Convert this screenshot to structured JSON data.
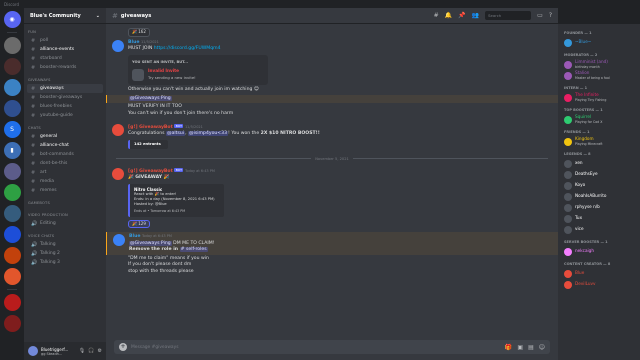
{
  "window": {
    "title": "Discord"
  },
  "server": {
    "name": "Blue's Community"
  },
  "categories": {
    "fun": "FUN",
    "giveaways": "GIVEAWAYS",
    "chats": "CHATS",
    "gamebots": "GAMEBOTS",
    "video_production": "VIDEO PRODUCTION",
    "voice_chats": "VOICE CHATS"
  },
  "fun_channels": [
    "poll",
    "alliance-events",
    "starboard",
    "booster-rewards"
  ],
  "giveaway_channels": [
    "giveaways",
    "booster-giveaways",
    "blues-freebies",
    "youtube-guide"
  ],
  "chat_channels": [
    "general",
    "alliance-chat",
    "bot-commands",
    "dont-be-this",
    "art",
    "media",
    "memes"
  ],
  "video_channels": [
    "Editing"
  ],
  "voice_channels": [
    "Talking",
    "Talking 2",
    "Talking 3"
  ],
  "user": {
    "name": "Bluetriggerf...",
    "tag": "gg Steadh..."
  },
  "chat": {
    "channel": "giveaways",
    "search_placeholder": "Search",
    "composer_placeholder": "Message #giveaways"
  },
  "messages": {
    "r1": "162",
    "m1_user": "Blue",
    "m1_time": "11/5/2021",
    "m1_text": "MUST JOIN ",
    "m1_link": "https://discord.gg/FUWMqm4",
    "invite_head": "YOU SENT AN INVITE, BUT...",
    "invite_title": "Invalid Invite",
    "invite_sub": "Try sending a new invite!",
    "m1_l2": "Otherwise you can't win and actually join im watching",
    "m1_l3": "@Giveaways Ping",
    "m1_l4": "MUST VERIFY IN IT TOO",
    "m1_l5": "You can't win if you don't join there's no harm",
    "m2_user": "[g!] GiveawayBot",
    "bot": "BOT",
    "m2_time": "11/5/2021",
    "m2_pre": "Congratulations ",
    "m2_men1": "@altsui",
    "m2_men2": "@isimp4you<33",
    "m2_mid": "! You won the ",
    "m2_prize": "2X $10 NITRO BOOST!!",
    "m2_entrants": "142 entrants",
    "date_divider": "November 5, 2021",
    "m3_user": "[g!] GiveawayBot",
    "m3_time": "Today at 6:43 PM",
    "m3_head": "GIVEAWAY",
    "embed_title": "Nitro Classic",
    "embed_l1": "React with 🎉 to enter!",
    "embed_l2": "Ends: in a day (November 8, 2021 6:43 PM)",
    "embed_l3": "Hosted by: @Blue",
    "embed_footer": "Ends at • Tomorrow at 6:43 PM",
    "r3": "129",
    "m4_user": "Blue",
    "m4_time": "Today at 6:43 PM",
    "m4_mention": "@Giveaways Ping",
    "m4_text": " DM ME TO CLAIM!",
    "m4_l2": "Remove the role in ",
    "m4_channel": "self-roles",
    "m4_l3": "\"DM me to claim\" means if you win",
    "m4_l4": "If you don't please dont dm",
    "m4_l5": "stop with the threads please"
  },
  "members": [
    {
      "role": "FOUNDER — 1",
      "items": [
        {
          "name": "~Blue~",
          "status": "",
          "color": "#3498db"
        }
      ]
    },
    {
      "role": "MODERATOR — 2",
      "items": [
        {
          "name": "Limminist (and)",
          "status": "birthday month",
          "color": "#9b59b6"
        },
        {
          "name": "Stalion",
          "status": "Master of being a fool",
          "color": "#9b59b6"
        }
      ]
    },
    {
      "role": "INTERN — 1",
      "items": [
        {
          "name": "The Infinite",
          "status": "Playing Tiny Fishing",
          "color": "#e91e63"
        }
      ]
    },
    {
      "role": "TOP BOOSTERS — 1",
      "items": [
        {
          "name": "Squirrel",
          "status": "Playing for Cod X",
          "color": "#2ecc71"
        }
      ]
    },
    {
      "role": "FRIENDS — 1",
      "items": [
        {
          "name": "Kingdom",
          "status": "Playing Minecraft",
          "color": "#f1c40f"
        }
      ]
    },
    {
      "role": "LEGENDS — 8",
      "items": [
        {
          "name": "xen",
          "status": "",
          "color": "#ffffff"
        },
        {
          "name": "DeathsEye",
          "status": "",
          "color": "#ffffff"
        },
        {
          "name": "Koyo",
          "status": "",
          "color": "#ffffff"
        },
        {
          "name": "NoahIsABurrito",
          "status": "",
          "color": "#ffffff"
        },
        {
          "name": "rphyyse n/b",
          "status": "",
          "color": "#ffffff"
        },
        {
          "name": "Tux",
          "status": "",
          "color": "#ffffff"
        },
        {
          "name": "vice",
          "status": "",
          "color": "#ffffff"
        }
      ]
    },
    {
      "role": "SERVER BOOSTER — 1",
      "items": [
        {
          "name": "nekcaigh",
          "status": "",
          "color": "#f47fff"
        }
      ]
    },
    {
      "role": "CONTENT CREATOR — 8",
      "items": [
        {
          "name": "Blue",
          "status": "",
          "color": "#e74c3c"
        },
        {
          "name": "DevilLuvv",
          "status": "",
          "color": "#e74c3c"
        }
      ]
    }
  ],
  "colors": {
    "accent": "#5865f2",
    "mention_bg": "#4752c4",
    "highlight": "#faa61a"
  }
}
